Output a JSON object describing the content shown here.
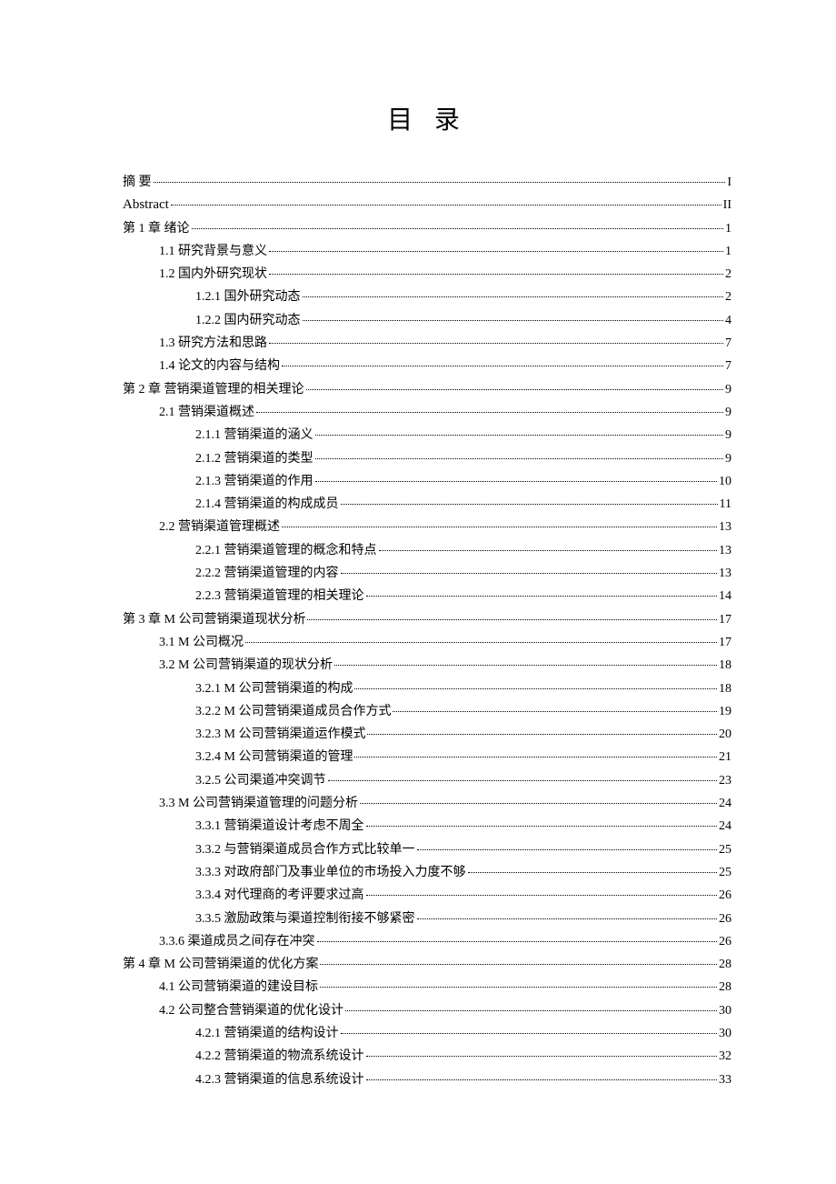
{
  "title": "目 录",
  "entries": [
    {
      "level": 0,
      "label": "摘 要",
      "page": "I"
    },
    {
      "level": 0,
      "label": "Abstract",
      "page": "II",
      "en": true
    },
    {
      "level": 0,
      "label": "第 1 章 绪论",
      "page": "1"
    },
    {
      "level": 1,
      "label": "1.1 研究背景与意义",
      "page": "1"
    },
    {
      "level": 1,
      "label": "1.2 国内外研究现状",
      "page": "2"
    },
    {
      "level": 2,
      "label": "1.2.1 国外研究动态",
      "page": "2"
    },
    {
      "level": 2,
      "label": "1.2.2 国内研究动态",
      "page": "4"
    },
    {
      "level": 1,
      "label": "1.3 研究方法和思路",
      "page": "7"
    },
    {
      "level": 1,
      "label": "1.4 论文的内容与结构",
      "page": "7"
    },
    {
      "level": 0,
      "label": "第 2 章 营销渠道管理的相关理论",
      "page": "9"
    },
    {
      "level": 1,
      "label": "2.1 营销渠道概述",
      "page": "9"
    },
    {
      "level": 2,
      "label": "2.1.1 营销渠道的涵义",
      "page": "9"
    },
    {
      "level": 2,
      "label": "2.1.2 营销渠道的类型",
      "page": "9"
    },
    {
      "level": 2,
      "label": "2.1.3 营销渠道的作用",
      "page": "10"
    },
    {
      "level": 2,
      "label": "2.1.4 营销渠道的构成成员",
      "page": "11"
    },
    {
      "level": 1,
      "label": "2.2 营销渠道管理概述",
      "page": "13"
    },
    {
      "level": 2,
      "label": "2.2.1 营销渠道管理的概念和特点",
      "page": "13"
    },
    {
      "level": 2,
      "label": "2.2.2 营销渠道管理的内容",
      "page": "13"
    },
    {
      "level": 2,
      "label": "2.2.3 营销渠道管理的相关理论",
      "page": "14"
    },
    {
      "level": 0,
      "label": "第 3 章  M 公司营销渠道现状分析",
      "page": "17"
    },
    {
      "level": 1,
      "label": "3.1 M 公司概况",
      "page": "17"
    },
    {
      "level": 1,
      "label": "3.2  M 公司营销渠道的现状分析",
      "page": "18"
    },
    {
      "level": 2,
      "label": "3.2.1  M 公司营销渠道的构成",
      "page": "18"
    },
    {
      "level": 2,
      "label": "3.2.2  M 公司营销渠道成员合作方式",
      "page": "19"
    },
    {
      "level": 2,
      "label": "3.2.3  M 公司营销渠道运作模式",
      "page": "20"
    },
    {
      "level": 2,
      "label": "3.2.4  M 公司营销渠道的管理",
      "page": "21"
    },
    {
      "level": 2,
      "label": "3.2.5 公司渠道冲突调节",
      "page": "23"
    },
    {
      "level": 1,
      "label": "3.3  M 公司营销渠道管理的问题分析",
      "page": "24"
    },
    {
      "level": 2,
      "label": "3.3.1 营销渠道设计考虑不周全",
      "page": "24"
    },
    {
      "level": 2,
      "label": "3.3.2 与营销渠道成员合作方式比较单一",
      "page": "25"
    },
    {
      "level": 2,
      "label": "3.3.3 对政府部门及事业单位的市场投入力度不够",
      "page": "25"
    },
    {
      "level": 2,
      "label": "3.3.4 对代理商的考评要求过高",
      "page": "26"
    },
    {
      "level": 2,
      "label": "3.3.5 激励政策与渠道控制衔接不够紧密",
      "page": "26"
    },
    {
      "level": 1,
      "label": "3.3.6 渠道成员之间存在冲突",
      "page": "26"
    },
    {
      "level": 0,
      "label": "第 4 章  M 公司营销渠道的优化方案",
      "page": "28"
    },
    {
      "level": 1,
      "label": "4.1 公司营销渠道的建设目标",
      "page": "28"
    },
    {
      "level": 1,
      "label": "4.2 公司整合营销渠道的优化设计",
      "page": "30"
    },
    {
      "level": 2,
      "label": "4.2.1 营销渠道的结构设计",
      "page": "30"
    },
    {
      "level": 2,
      "label": "4.2.2 营销渠道的物流系统设计",
      "page": "32"
    },
    {
      "level": 2,
      "label": "4.2.3 营销渠道的信息系统设计",
      "page": "33"
    }
  ]
}
